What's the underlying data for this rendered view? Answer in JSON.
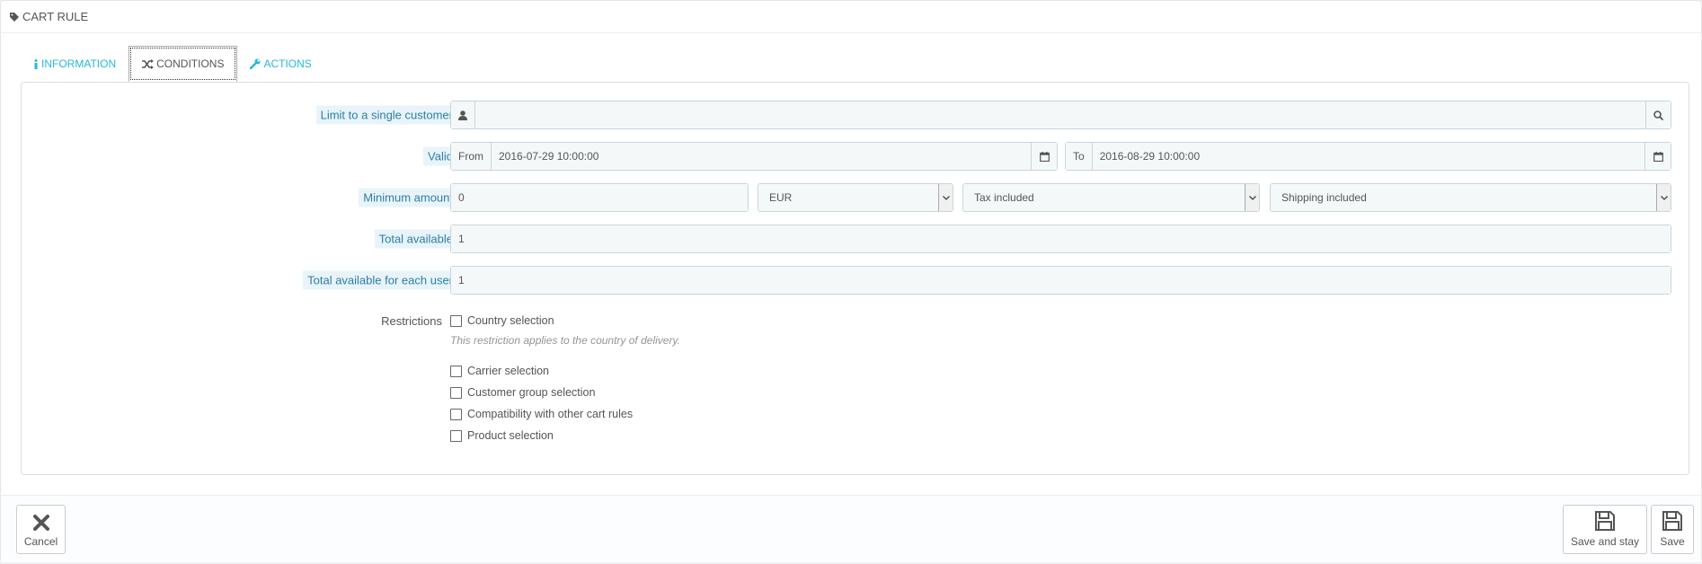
{
  "panel": {
    "title": "CART RULE",
    "icon": "tag-icon"
  },
  "tabs": [
    {
      "label": "INFORMATION",
      "icon": "info-icon",
      "active": false
    },
    {
      "label": "CONDITIONS",
      "icon": "random-icon",
      "active": true
    },
    {
      "label": "ACTIONS",
      "icon": "wrench-icon",
      "active": false
    }
  ],
  "fields": {
    "customer": {
      "label": "Limit to a single customer",
      "value": ""
    },
    "valid": {
      "label": "Valid",
      "from_label": "From",
      "from_value": "2016-07-29 10:00:00",
      "to_label": "To",
      "to_value": "2016-08-29 10:00:00"
    },
    "minimum": {
      "label": "Minimum amount",
      "value": "0",
      "currency": "EUR",
      "tax": "Tax included",
      "shipping": "Shipping included"
    },
    "total": {
      "label": "Total available",
      "value": "1"
    },
    "per_user": {
      "label": "Total available for each user",
      "value": "1"
    }
  },
  "restrictions": {
    "label": "Restrictions",
    "country": "Country selection",
    "country_help": "This restriction applies to the country of delivery.",
    "carrier": "Carrier selection",
    "group": "Customer group selection",
    "compat": "Compatibility with other cart rules",
    "product": "Product selection"
  },
  "buttons": {
    "cancel": "Cancel",
    "save_stay": "Save and stay",
    "save": "Save"
  },
  "colors": {
    "accent": "#25b9d7",
    "label_hint_bg": "#e8f4fa",
    "input_bg": "#f5f8f9",
    "cancel_x": "#555555"
  }
}
